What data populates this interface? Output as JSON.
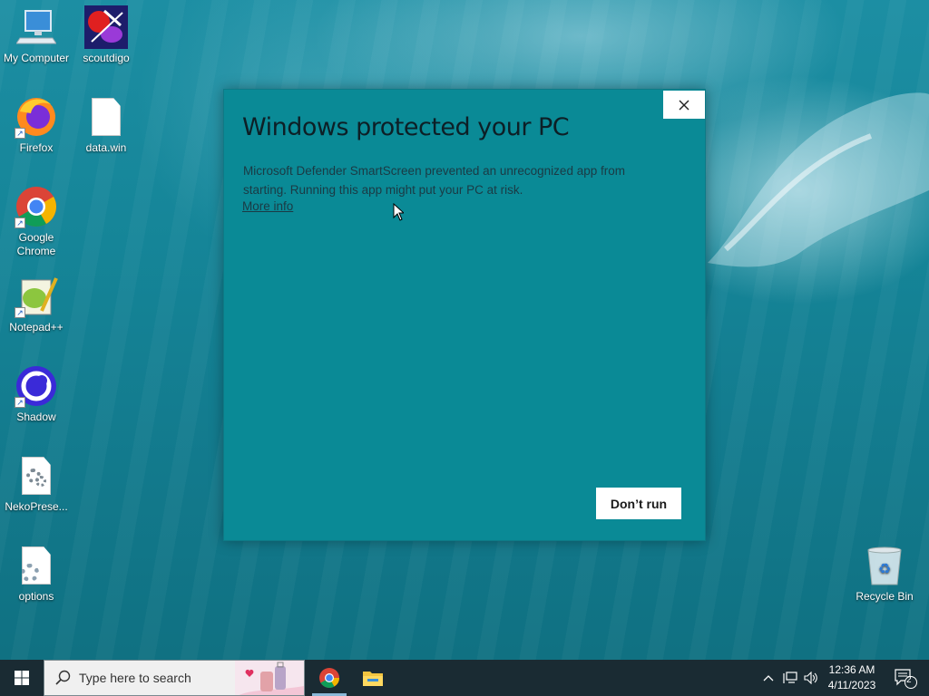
{
  "desktop": {
    "icons": [
      {
        "label": "My Computer"
      },
      {
        "label": "scoutdigo"
      },
      {
        "label": "Firefox"
      },
      {
        "label": "data.win"
      },
      {
        "label": "Google Chrome"
      },
      {
        "label": "Notepad++"
      },
      {
        "label": "Shadow"
      },
      {
        "label": "NekoPrese..."
      },
      {
        "label": "options"
      },
      {
        "label": "Recycle Bin"
      }
    ]
  },
  "dialog": {
    "title": "Windows protected your PC",
    "message": "Microsoft Defender SmartScreen prevented an unrecognized app from starting. Running this app might put your PC at risk.",
    "more_info_link": "More info",
    "primary_button": "Don’t run",
    "close_icon": "close-icon",
    "background_color": "#0a8a96"
  },
  "taskbar": {
    "search_placeholder": "Type here to search",
    "pinned_apps": [
      "chrome-icon",
      "file-explorer-icon"
    ],
    "clock_time": "12:36 AM",
    "clock_date": "4/11/2023",
    "notification_count": "2"
  }
}
